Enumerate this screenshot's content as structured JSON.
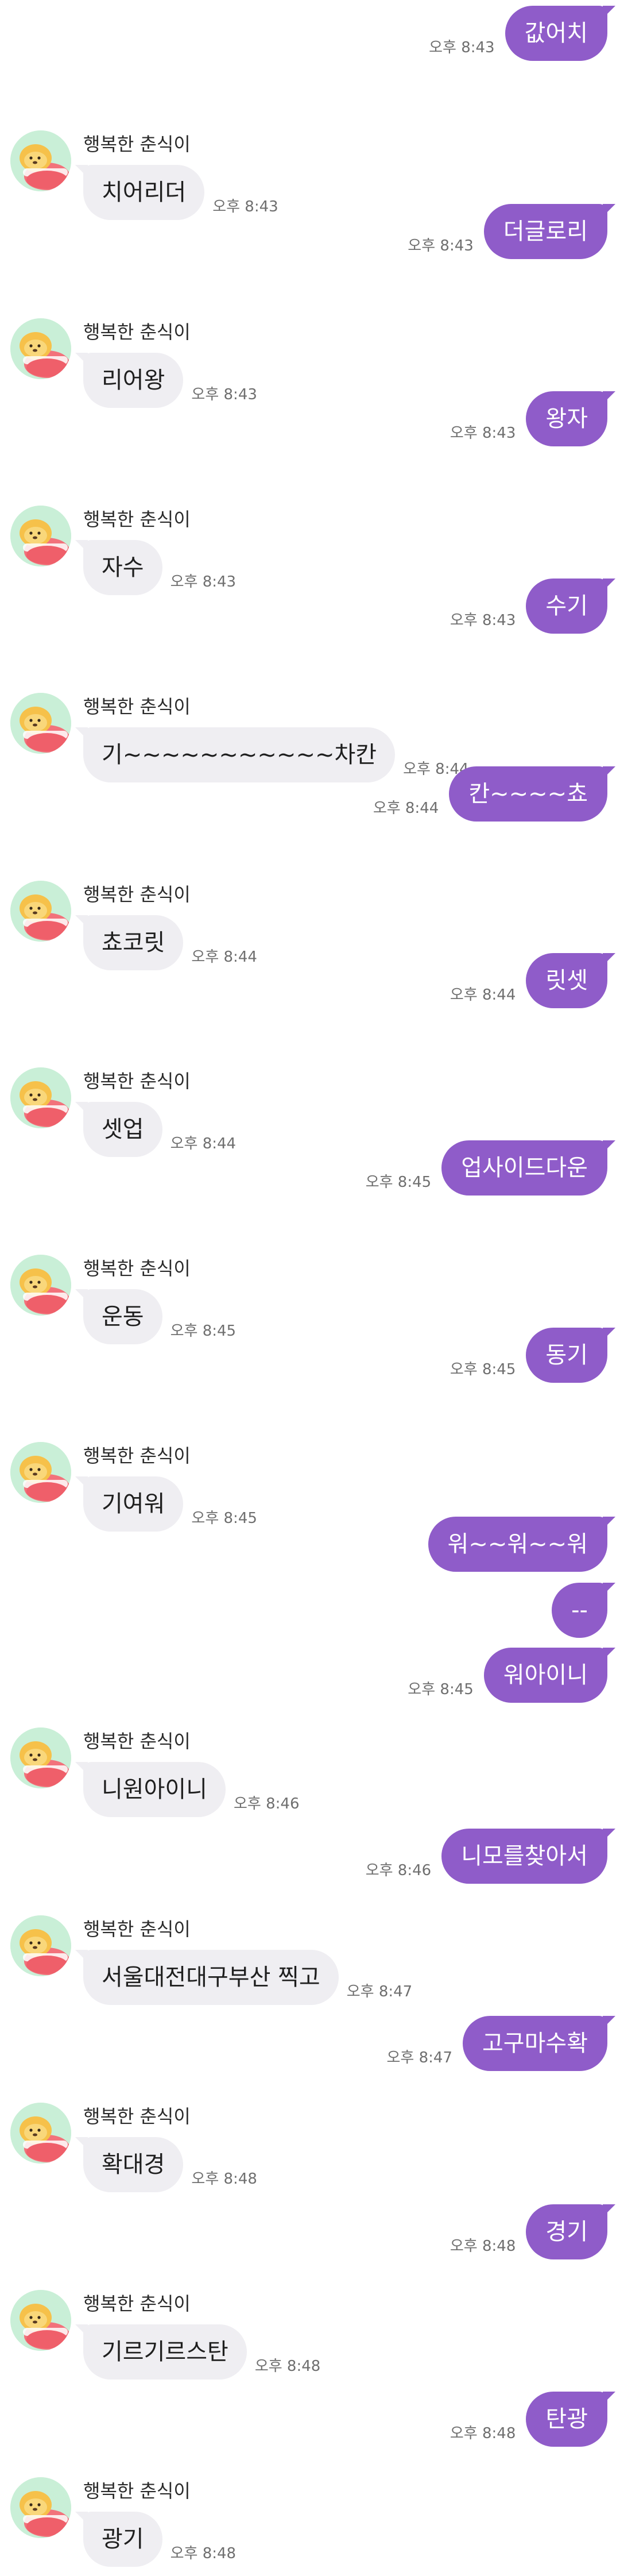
{
  "contact": {
    "name": "행복한 춘식이",
    "avatar_icon": "chunsik-sleeping-avatar-icon"
  },
  "colors": {
    "outgoing_bubble": "#8f5cc9",
    "incoming_bubble": "#efeef2",
    "timestamp": "#6f6f6f",
    "background": "#ffffff"
  },
  "messages": [
    {
      "dir": "out",
      "text": "값어치",
      "time": "오후 8:43"
    },
    {
      "dir": "in",
      "text": "치어리더",
      "time": "오후 8:43"
    },
    {
      "dir": "out",
      "text": "더글로리",
      "time": "오후 8:43"
    },
    {
      "dir": "in",
      "text": "리어왕",
      "time": "오후 8:43"
    },
    {
      "dir": "out",
      "text": "왕자",
      "time": "오후 8:43"
    },
    {
      "dir": "in",
      "text": "자수",
      "time": "오후 8:43"
    },
    {
      "dir": "out",
      "text": "수기",
      "time": "오후 8:43"
    },
    {
      "dir": "in",
      "text": "기~~~~~~~~~~~차칸",
      "time": "오후 8:44"
    },
    {
      "dir": "out",
      "text": "칸~~~~쵸",
      "time": "오후 8:44"
    },
    {
      "dir": "in",
      "text": "쵸코릿",
      "time": "오후 8:44"
    },
    {
      "dir": "out",
      "text": "릿셋",
      "time": "오후 8:44"
    },
    {
      "dir": "in",
      "text": "셋업",
      "time": "오후 8:44"
    },
    {
      "dir": "out",
      "text": "업사이드다운",
      "time": "오후 8:45"
    },
    {
      "dir": "in",
      "text": "운동",
      "time": "오후 8:45"
    },
    {
      "dir": "out",
      "text": "동기",
      "time": "오후 8:45"
    },
    {
      "dir": "in",
      "text": "기여워",
      "time": "오후 8:45"
    },
    {
      "dir": "out",
      "text": "워~~워~~워",
      "time": ""
    },
    {
      "dir": "out",
      "text": "--",
      "time": ""
    },
    {
      "dir": "out",
      "text": "워아이니",
      "time": "오후 8:45"
    },
    {
      "dir": "in",
      "text": "니원아이니",
      "time": "오후 8:46"
    },
    {
      "dir": "out",
      "text": "니모를찾아서",
      "time": "오후 8:46"
    },
    {
      "dir": "in",
      "text": "서울대전대구부산 찍고",
      "time": "오후 8:47"
    },
    {
      "dir": "out",
      "text": "고구마수확",
      "time": "오후 8:47"
    },
    {
      "dir": "in",
      "text": "확대경",
      "time": "오후 8:48"
    },
    {
      "dir": "out",
      "text": "경기",
      "time": "오후 8:48"
    },
    {
      "dir": "in",
      "text": "기르기르스탄",
      "time": "오후 8:48"
    },
    {
      "dir": "out",
      "text": "탄광",
      "time": "오후 8:48"
    },
    {
      "dir": "in",
      "text": "광기",
      "time": "오후 8:48"
    }
  ]
}
